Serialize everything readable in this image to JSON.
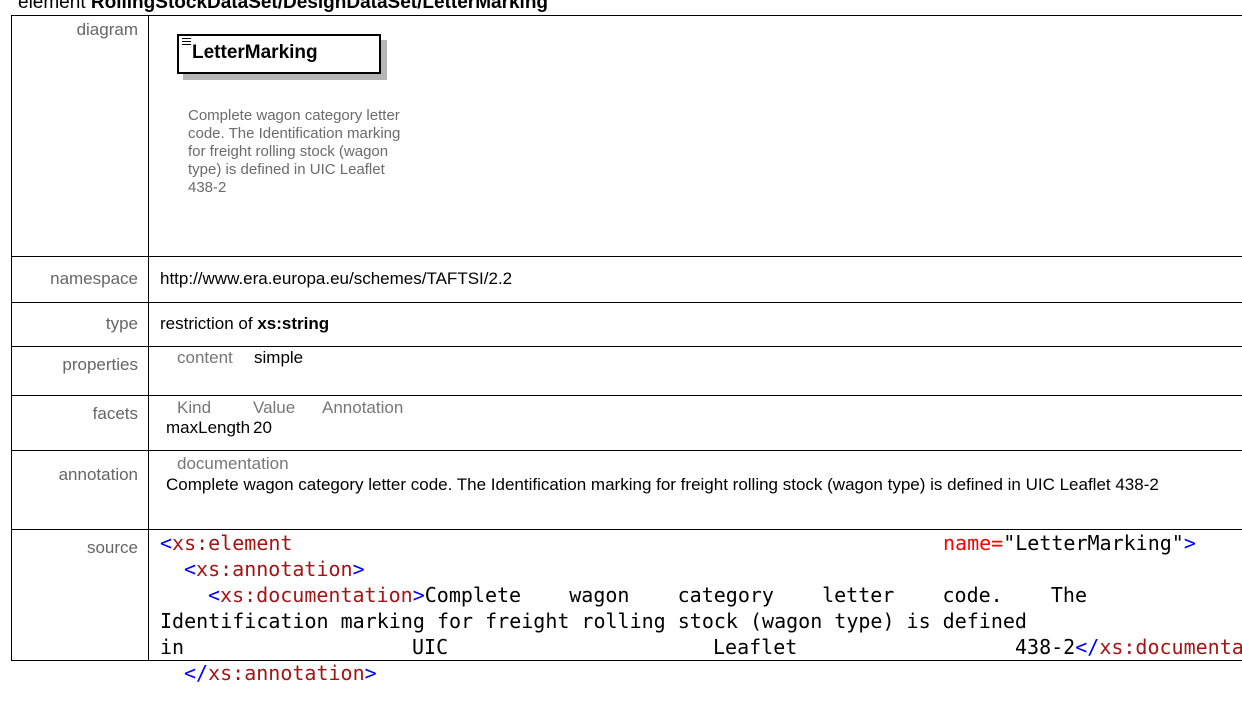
{
  "header": {
    "prefix": "element",
    "path": "RollingStockDataSet/DesignDataSet/LetterMarking"
  },
  "diagram": {
    "label": "diagram",
    "element_name": "LetterMarking",
    "icon": "element-list-icon",
    "description": "Complete wagon category letter code. The Identification marking for freight rolling stock (wagon type) is defined in UIC Leaflet 438-2"
  },
  "namespace": {
    "label": "namespace",
    "value": "http://www.era.europa.eu/schemes/TAFTSI/2.2"
  },
  "type": {
    "label": "type",
    "prefix": "restriction of ",
    "base": "xs:string"
  },
  "properties": {
    "label": "properties",
    "key": "content",
    "value": "simple"
  },
  "facets": {
    "label": "facets",
    "headers": [
      "Kind",
      "Value",
      "Annotation"
    ],
    "rows": [
      {
        "kind": "maxLength",
        "value": "20",
        "annotation": ""
      }
    ]
  },
  "annotation": {
    "label": "annotation",
    "heading": "documentation",
    "text": "Complete wagon category letter code. The Identification marking for freight rolling stock (wagon type) is defined in UIC Leaflet 438-2"
  },
  "source": {
    "label": "source",
    "open_tag": "<",
    "close_tag": ">",
    "end_open": "</",
    "element_tag": "xs:element",
    "name_attr": "name=",
    "name_value": "\"LetterMarking\"",
    "annotation_tag": "xs:annotation",
    "documentation_tag": "xs:documentation",
    "doc_line1": "Complete    wagon    category    letter    code.    The",
    "doc_line2": "Identification marking for freight rolling stock (wagon type) is defined",
    "doc_line3_a": "in",
    "doc_line3_b": "UIC",
    "doc_line3_c": "Leaflet",
    "doc_line3_d": "438-2"
  },
  "colors": {
    "tag_bracket": "#0000ff",
    "tag_name": "#a31515",
    "attribute": "#ff0000",
    "label_text": "#666666",
    "diagram_shadow": "#b5b5b5"
  }
}
